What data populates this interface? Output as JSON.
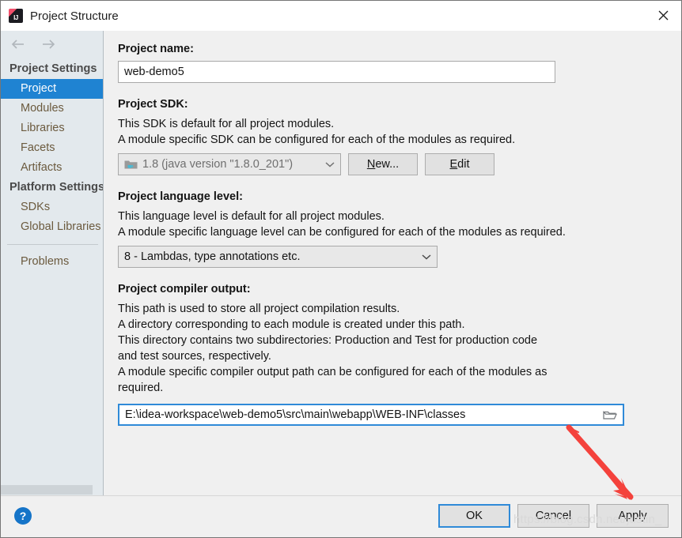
{
  "window": {
    "title": "Project Structure",
    "logo_icon": "intellij-idea-logo",
    "close_icon": "close-icon"
  },
  "sidebar": {
    "nav": {
      "back_icon": "arrow-left-icon",
      "forward_icon": "arrow-right-icon"
    },
    "groups": [
      {
        "label": "Project Settings",
        "items": [
          {
            "label": "Project",
            "selected": true
          },
          {
            "label": "Modules",
            "selected": false
          },
          {
            "label": "Libraries",
            "selected": false
          },
          {
            "label": "Facets",
            "selected": false
          },
          {
            "label": "Artifacts",
            "selected": false
          }
        ]
      },
      {
        "label": "Platform Settings",
        "items": [
          {
            "label": "SDKs",
            "selected": false
          },
          {
            "label": "Global Libraries",
            "selected": false
          }
        ]
      }
    ],
    "problems_label": "Problems",
    "selected_color": "#1f83d2"
  },
  "main": {
    "project_name": {
      "label": "Project name:",
      "value": "web-demo5"
    },
    "project_sdk": {
      "label": "Project SDK:",
      "desc_line1": "This SDK is default for all project modules.",
      "desc_line2": "A module specific SDK can be configured for each of the modules as required.",
      "selected": "1.8 (java version \"1.8.0_201\")",
      "sdk_icon": "java-sdk-folder-icon",
      "chevron_icon": "chevron-down-icon",
      "new_button": "New...",
      "new_button_mnemonic": "N",
      "edit_button": "Edit",
      "edit_button_mnemonic": "E"
    },
    "language_level": {
      "label": "Project language level:",
      "desc_line1": "This language level is default for all project modules.",
      "desc_line2": "A module specific language level can be configured for each of the modules as required.",
      "selected": "8 - Lambdas, type annotations etc.",
      "chevron_icon": "chevron-down-icon"
    },
    "compiler_output": {
      "label": "Project compiler output:",
      "desc_line1": "This path is used to store all project compilation results.",
      "desc_line2": "A directory corresponding to each module is created under this path.",
      "desc_line3": "This directory contains two subdirectories: Production and Test for production code",
      "desc_line4": "and test sources, respectively.",
      "desc_line5": "A module specific compiler output path can be configured for each of the modules as",
      "desc_line6": "required.",
      "path_value": "E:\\idea-workspace\\web-demo5\\src\\main\\webapp\\WEB-INF\\classes",
      "browse_icon": "folder-browse-icon",
      "focus_color": "#2f8ad8"
    }
  },
  "footer": {
    "help_icon": "help-question-icon",
    "ok_label": "OK",
    "cancel_label": "Cancel",
    "apply_label": "Apply"
  },
  "annotations": {
    "arrow_color": "#f4423c",
    "arrow_icon": "red-pointer-arrow",
    "watermark_text": "https://blog.csdn.net/justin_"
  }
}
